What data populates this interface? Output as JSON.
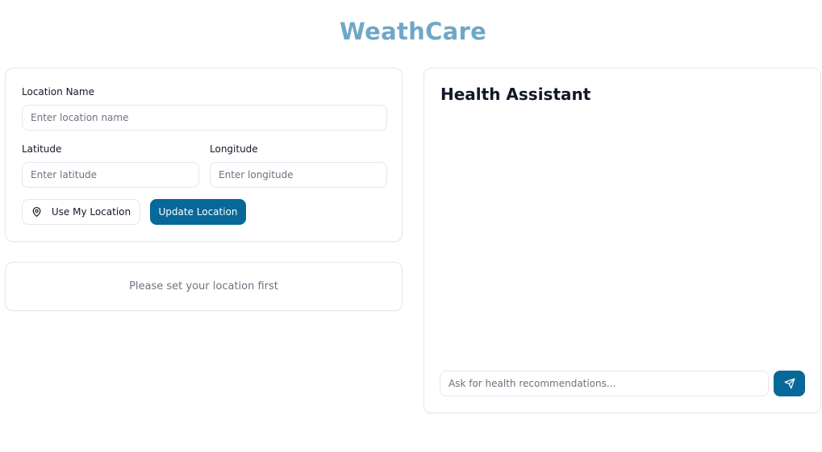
{
  "app": {
    "title": "WeathCare"
  },
  "location_form": {
    "name_label": "Location Name",
    "name_placeholder": "Enter location name",
    "name_value": "",
    "latitude_label": "Latitude",
    "latitude_placeholder": "Enter latitude",
    "latitude_value": "",
    "longitude_label": "Longitude",
    "longitude_placeholder": "Enter longitude",
    "longitude_value": "",
    "use_location_label": "Use My Location",
    "update_label": "Update Location"
  },
  "status": {
    "message": "Please set your location first"
  },
  "assistant": {
    "title": "Health Assistant",
    "input_placeholder": "Ask for health recommendations...",
    "input_value": ""
  },
  "icons": {
    "use_location": "map-pin-icon",
    "send": "send-icon"
  },
  "colors": {
    "brand_title": "#6fa7c8",
    "primary": "#076999",
    "border": "#e5e7eb",
    "muted_text": "#6b7280"
  }
}
